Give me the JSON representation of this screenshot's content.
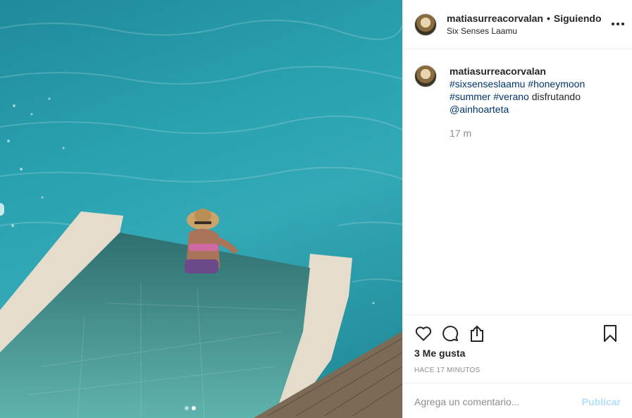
{
  "post": {
    "username": "matiasurreacorvalan",
    "separator": "•",
    "follow_status": "Siguiendo",
    "location": "Six Senses Laamu"
  },
  "caption": {
    "username": "matiasurreacorvalan",
    "hashtags": [
      "#sixsenseslaamu",
      "#honeymoon",
      "#summer",
      "#verano"
    ],
    "text": "disfrutando",
    "mention": "@ainhoarteta",
    "time": "17 m"
  },
  "engagement": {
    "likes": "3 Me gusta",
    "timestamp": "HACE 17 MINUTOS"
  },
  "comment": {
    "placeholder": "Agrega un comentario...",
    "post_label": "Publicar"
  },
  "carousel": {
    "slides": 2,
    "active_slide": 2
  },
  "icons": {
    "more": "more-options-icon",
    "like": "heart-icon",
    "comment": "comment-bubble-icon",
    "share": "share-icon",
    "save": "bookmark-icon"
  },
  "colors": {
    "link": "#003569",
    "muted": "#8e8e8e",
    "post_button_disabled": "#b2dffc",
    "water": "#2aa2b0"
  }
}
